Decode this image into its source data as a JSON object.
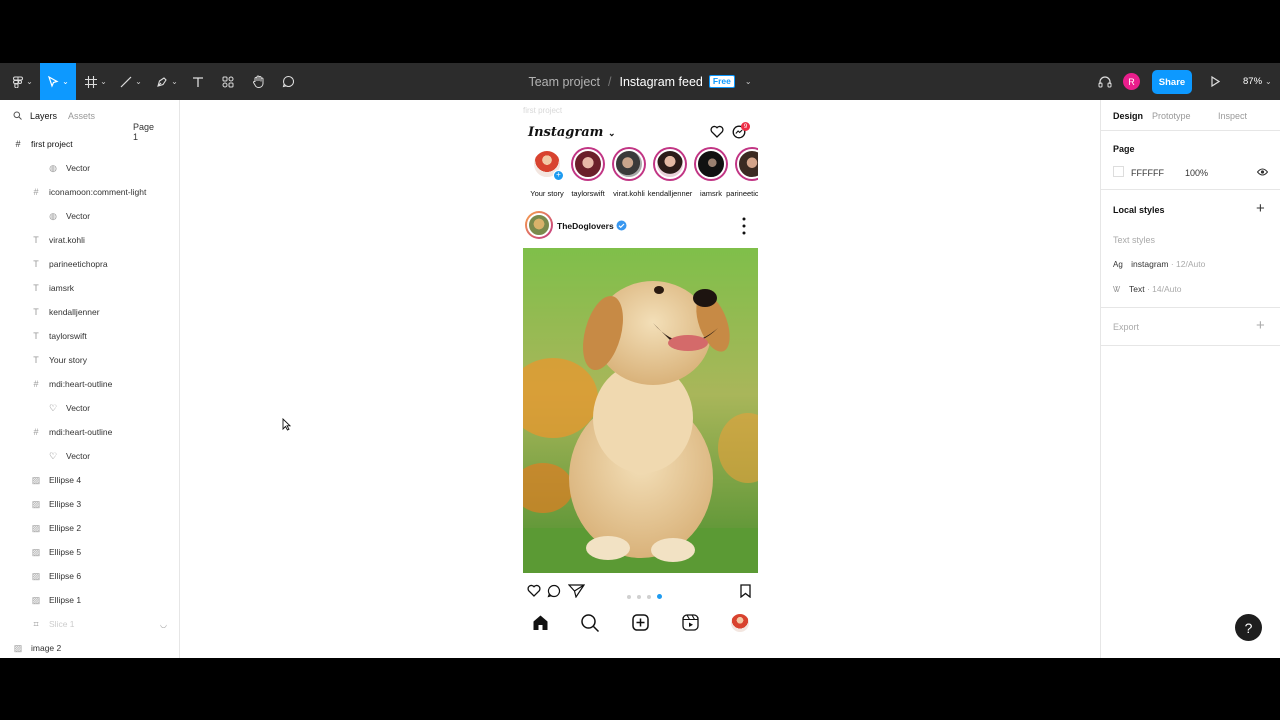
{
  "toolbar": {
    "breadcrumb_team": "Team project",
    "breadcrumb_sep": "/",
    "file_name": "Instagram feed",
    "plan_badge": "Free",
    "share_label": "Share",
    "avatar_initial": "R",
    "zoom": "87%",
    "icons": [
      "figma-menu-icon",
      "move-tool-icon",
      "frame-tool-icon",
      "line-tool-icon",
      "pen-tool-icon",
      "text-tool-icon",
      "resources-icon",
      "hand-tool-icon",
      "comment-tool-icon",
      "headphones-icon",
      "play-icon"
    ],
    "accent": "#0d99ff"
  },
  "left_panel": {
    "tab_layers": "Layers",
    "tab_assets": "Assets",
    "page_select": "Page 1",
    "frame_name": "first project",
    "layers": [
      {
        "label": "Vector",
        "icon": "vector"
      },
      {
        "label": "iconamoon:comment-light",
        "icon": "frame"
      },
      {
        "label": "Vector",
        "icon": "vector"
      },
      {
        "label": "virat.kohli",
        "icon": "text"
      },
      {
        "label": "parineetichopra",
        "icon": "text"
      },
      {
        "label": "iamsrk",
        "icon": "text"
      },
      {
        "label": "kendalljenner",
        "icon": "text"
      },
      {
        "label": "taylorswift",
        "icon": "text"
      },
      {
        "label": "Your story",
        "icon": "text"
      },
      {
        "label": "mdi:heart-outline",
        "icon": "frame"
      },
      {
        "label": "Vector",
        "icon": "heart"
      },
      {
        "label": "mdi:heart-outline",
        "icon": "frame"
      },
      {
        "label": "Vector",
        "icon": "heart"
      },
      {
        "label": "Ellipse 4",
        "icon": "image"
      },
      {
        "label": "Ellipse 3",
        "icon": "image"
      },
      {
        "label": "Ellipse 2",
        "icon": "image"
      },
      {
        "label": "Ellipse 5",
        "icon": "image"
      },
      {
        "label": "Ellipse 6",
        "icon": "image"
      },
      {
        "label": "Ellipse 1",
        "icon": "image"
      },
      {
        "label": "Slice 1",
        "icon": "slice"
      }
    ],
    "bottom_layer": "image 2"
  },
  "canvas": {
    "frame_label": "first project",
    "app_logo": "Instagram",
    "notification_count": "9",
    "stories": [
      "Your story",
      "taylorswift",
      "virat.kohli",
      "kendalljenner",
      "iamsrk",
      "parineetichopra"
    ],
    "post_user": "TheDoglovers",
    "carousel_dots": 4,
    "carousel_active": 4
  },
  "right_panel": {
    "tab_design": "Design",
    "tab_prototype": "Prototype",
    "tab_inspect": "Inspect",
    "page_heading": "Page",
    "page_color": "FFFFFF",
    "page_opacity": "100%",
    "local_styles": "Local styles",
    "text_styles": "Text styles",
    "style1_name": "instagram",
    "style1_meta": " · 12/Auto",
    "style2_name": "Text",
    "style2_meta": " · 14/Auto",
    "export": "Export",
    "add_symbol": "+"
  },
  "help_label": "?"
}
